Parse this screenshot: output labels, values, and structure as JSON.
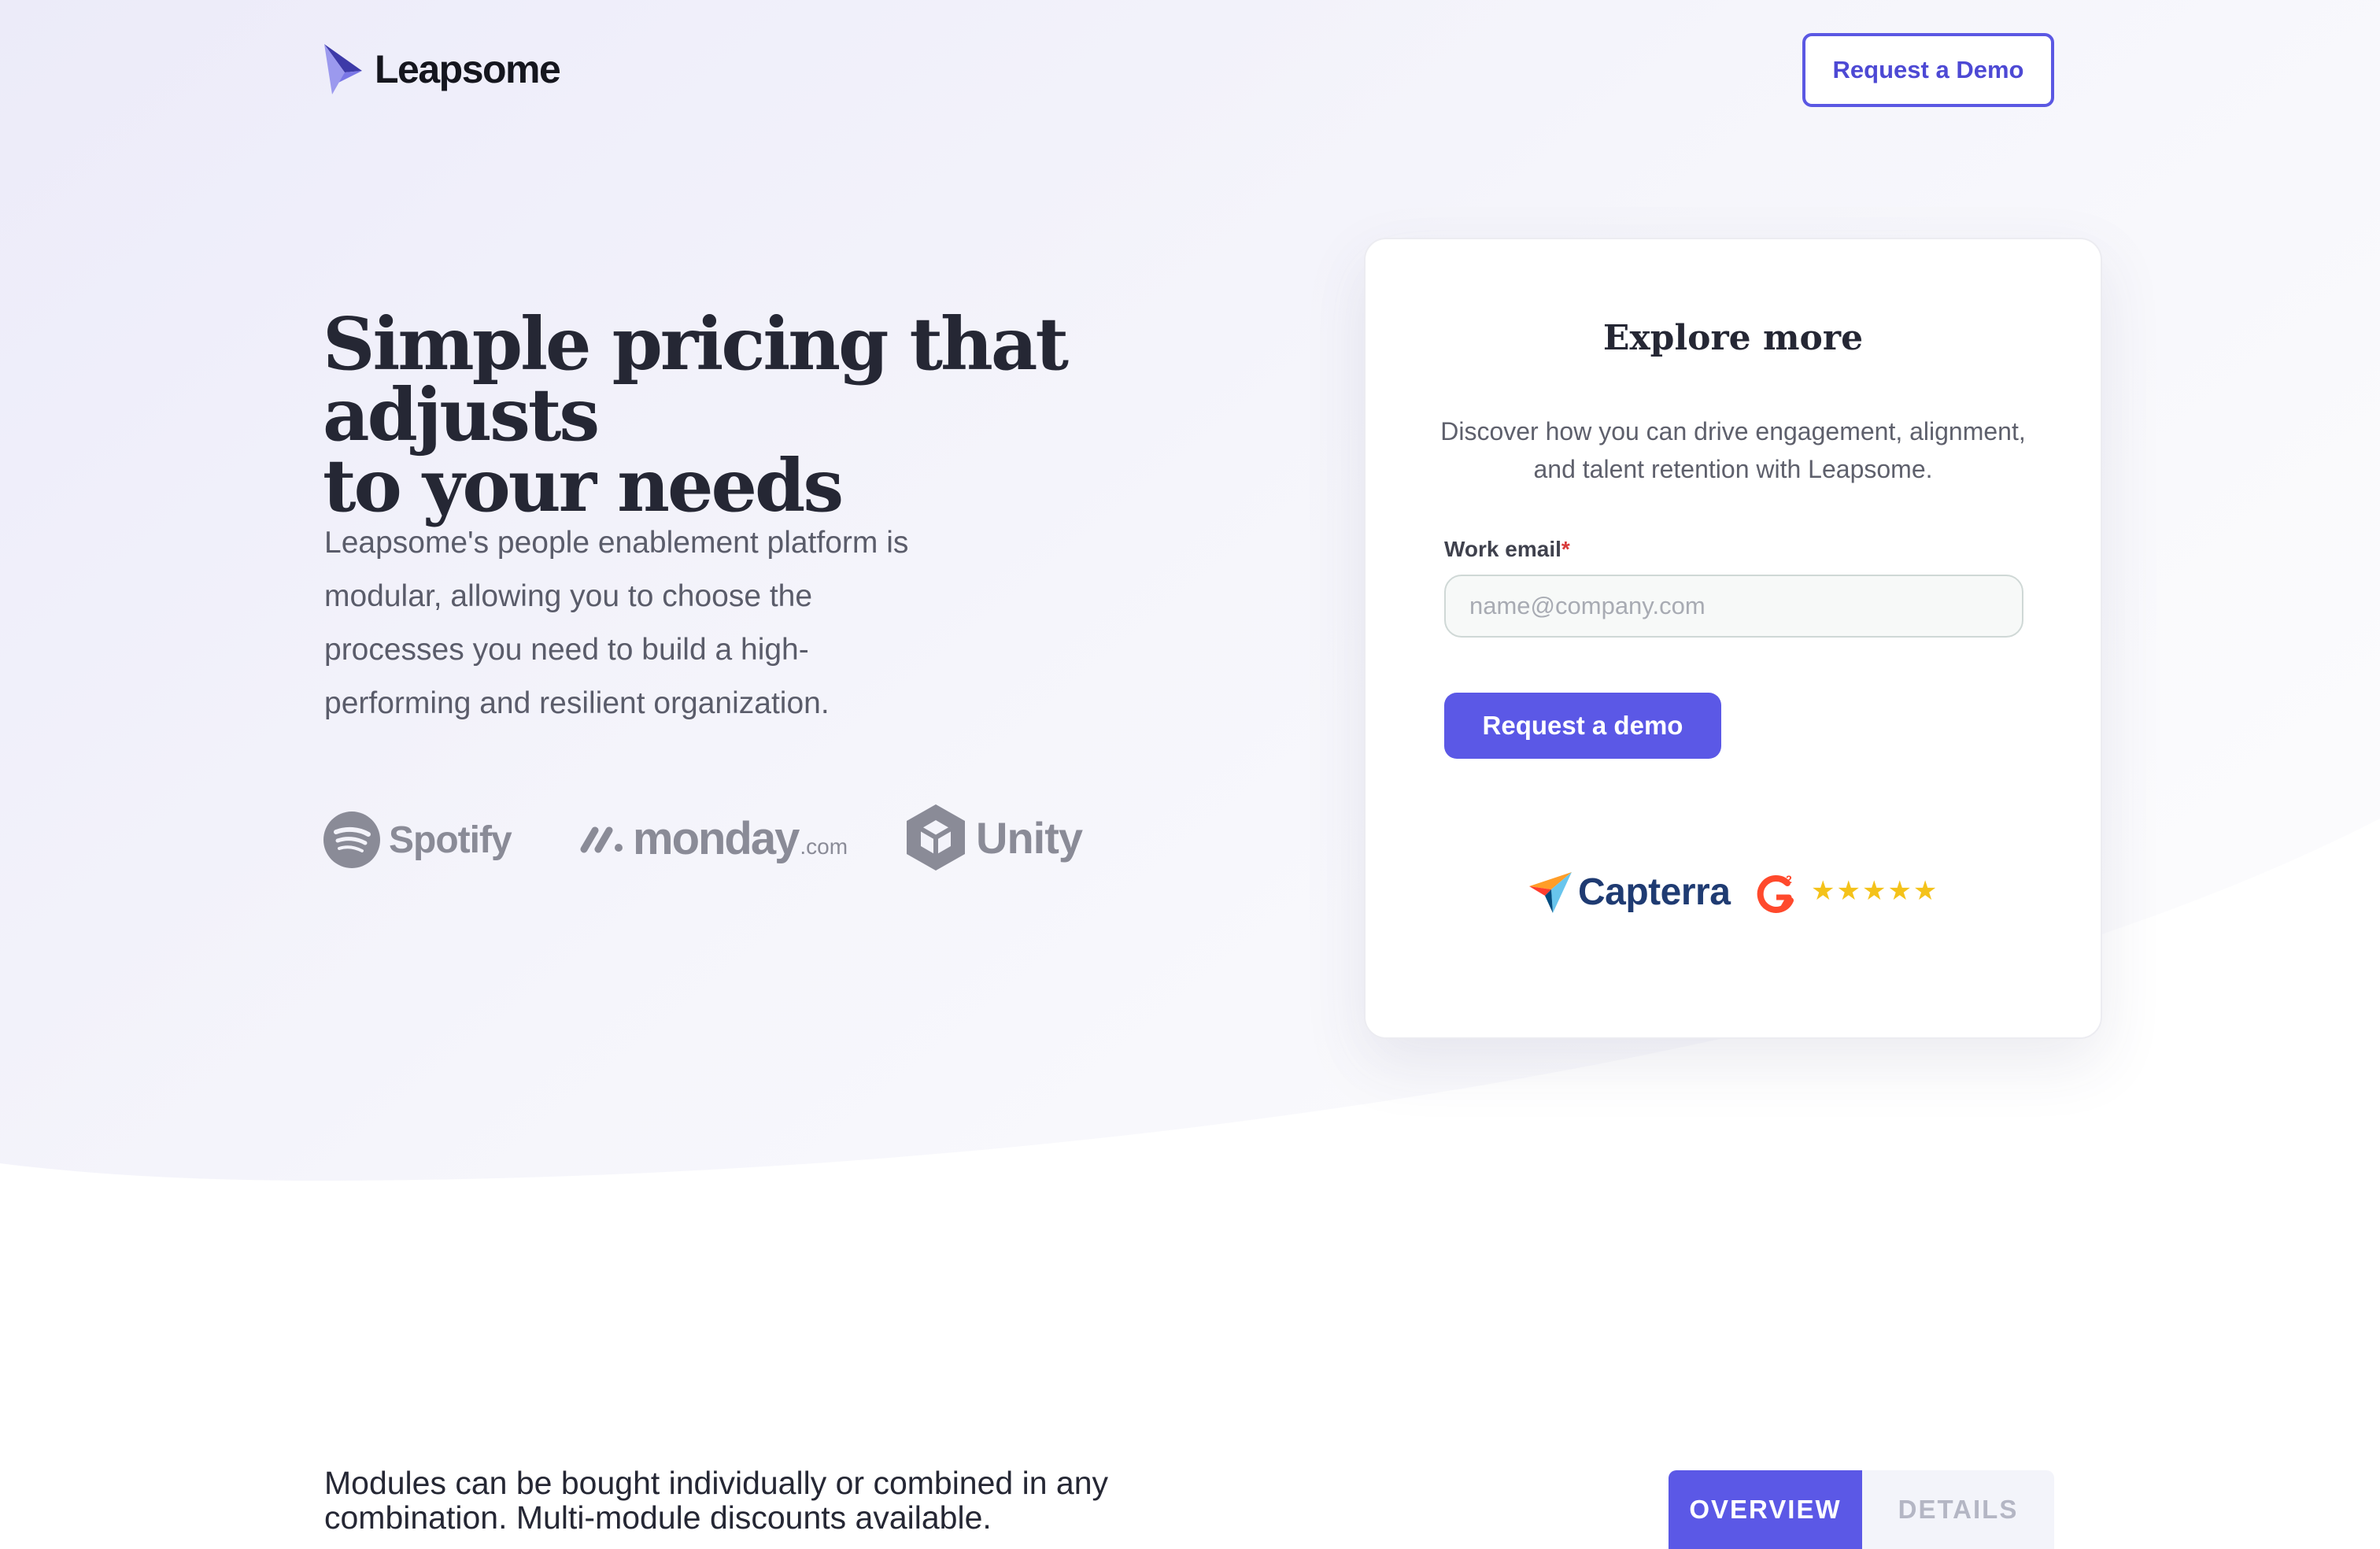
{
  "header": {
    "brand": "Leapsome",
    "cta_label": "Request a Demo"
  },
  "hero": {
    "title_line1": "Simple pricing that adjusts",
    "title_line2": "to your needs",
    "subtitle": "Leapsome's people enablement platform is modular, allowing you to choose the processes you need to build a high-performing and resilient organization."
  },
  "customer_logos": {
    "spotify": "Spotify",
    "monday": "monday",
    "monday_suffix": ".com",
    "unity": "Unity"
  },
  "card": {
    "title": "Explore more",
    "description": "Discover how you can drive engagement, alignment, and talent retention with Leapsome.",
    "email_label": "Work email",
    "required_marker": "*",
    "email_placeholder": "name@company.com",
    "email_value": "",
    "submit_label": "Request a demo",
    "ratings": {
      "capterra": "Capterra",
      "stars": "★★★★★",
      "star_count": 5
    }
  },
  "modules": {
    "text": "Modules can be bought individually or combined in any combination. Multi-module discounts available.",
    "tabs": [
      {
        "label": "OVERVIEW",
        "active": true
      },
      {
        "label": "DETAILS",
        "active": false
      }
    ]
  },
  "colors": {
    "accent": "#5b58e6",
    "hero_background": "#f1f1fa",
    "text_dark": "#252734",
    "text_muted": "#5a5c6a",
    "logo_grey": "#8a8b97",
    "star": "#f4c21a"
  },
  "icons": {
    "brand": "leapsome-logo-icon",
    "spotify": "spotify-logo-icon",
    "monday": "monday-logo-icon",
    "unity": "unity-logo-icon",
    "capterra": "capterra-logo-icon",
    "g2": "g2-logo-icon",
    "stars": "star-rating-icon"
  }
}
